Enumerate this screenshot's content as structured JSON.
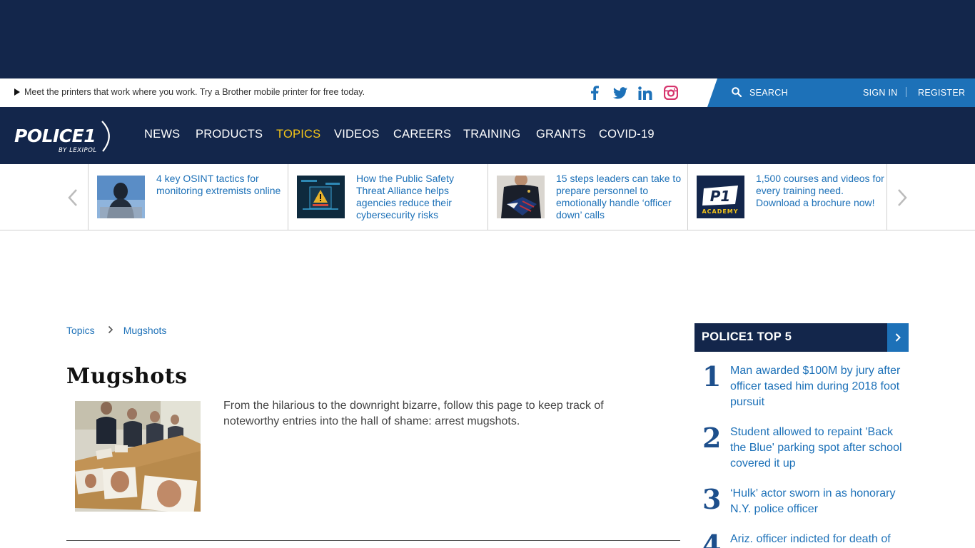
{
  "promo": {
    "text": "Meet the printers that work where you work. Try a Brother mobile printer for free today."
  },
  "social": {
    "icons": [
      "facebook-icon",
      "twitter-icon",
      "linkedin-icon",
      "instagram-icon"
    ],
    "color": "#1d71b8",
    "instagram_color": "#d6336c"
  },
  "header": {
    "search_label": "SEARCH",
    "sign_in": "SIGN IN",
    "register": "REGISTER"
  },
  "logo": {
    "name": "POLICE1",
    "tagline": "BY LEXIPOL"
  },
  "nav": {
    "items": [
      {
        "label": "NEWS"
      },
      {
        "label": "PRODUCTS"
      },
      {
        "label": "TOPICS",
        "active": true
      },
      {
        "label": "VIDEOS"
      },
      {
        "label": "CAREERS"
      },
      {
        "label": "TRAINING"
      },
      {
        "label": "GRANTS"
      },
      {
        "label": "COVID-19"
      }
    ]
  },
  "carousel": {
    "cards": [
      {
        "title": "4 key OSINT tactics for monitoring extremists online"
      },
      {
        "title": "How the Public Safety Threat Alliance helps agencies reduce their cybersecurity risks"
      },
      {
        "title": "15 steps leaders can take to prepare personnel to emotionally handle ‘officer down’ calls"
      },
      {
        "title": "1,500 courses and videos for every training need. Download a brochure now!",
        "badge": "P1",
        "badge_sub": "ACADEMY"
      }
    ]
  },
  "breadcrumb": {
    "items": [
      "Topics",
      "Mugshots"
    ]
  },
  "page": {
    "title": "Mugshots",
    "description": "From the hilarious to the downright bizarre, follow this page to keep track of noteworthy entries into the hall of shame: arrest mugshots."
  },
  "top5": {
    "title": "POLICE1 TOP 5",
    "items": [
      {
        "rank": "1",
        "title": "Man awarded $100M by jury after officer tased him during 2018 foot pursuit"
      },
      {
        "rank": "2",
        "title": "Student allowed to repaint 'Back the Blue' parking spot after school covered it up"
      },
      {
        "rank": "3",
        "title": "‘Hulk’ actor sworn in as honorary N.Y. police officer"
      },
      {
        "rank": "4",
        "title": "Ariz. officer indicted for death of"
      }
    ]
  },
  "colors": {
    "navy": "#13264b",
    "blue": "#1d71b8",
    "active_nav": "#f5c518"
  }
}
